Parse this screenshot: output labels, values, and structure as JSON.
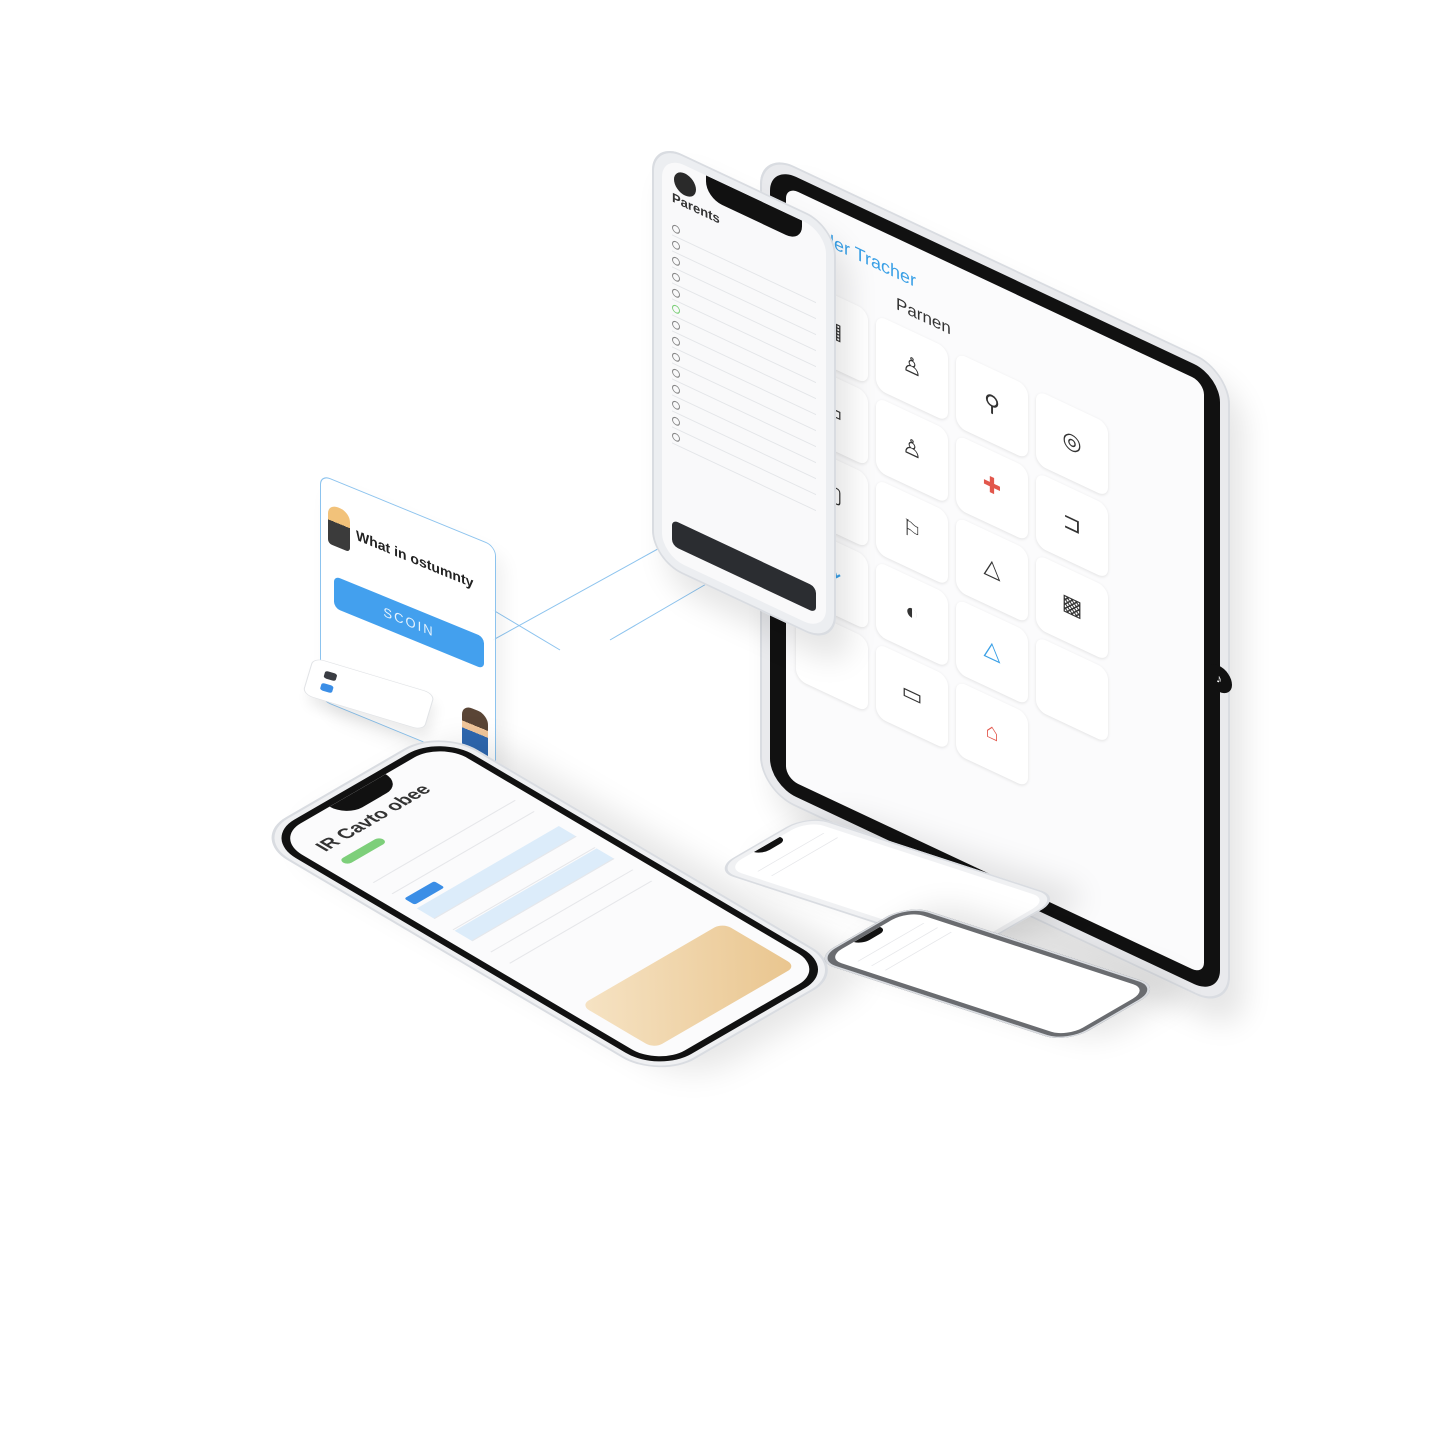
{
  "card": {
    "title": "What in ostumnty",
    "body": "",
    "button": "SCOIN"
  },
  "tag": {
    "line1": "",
    "line2": ""
  },
  "phoneA": {
    "title": "Parents",
    "rows": [
      "",
      "",
      "",
      "",
      "",
      "",
      "",
      "",
      "",
      "",
      "",
      "",
      "",
      ""
    ],
    "bottom_bar": ""
  },
  "tablet": {
    "title": "Order Tracher",
    "subtitle": "Parnen",
    "tiles": [
      {
        "icon": "▦",
        "label": ""
      },
      {
        "icon": "♙",
        "label": ""
      },
      {
        "icon": "⚲",
        "label": ""
      },
      {
        "icon": "◎",
        "label": ""
      },
      {
        "icon": "▭",
        "label": ""
      },
      {
        "icon": "♙",
        "label": ""
      },
      {
        "icon": "✚",
        "label": ""
      },
      {
        "icon": "⊐",
        "label": ""
      },
      {
        "icon": "▢",
        "label": ""
      },
      {
        "icon": "⚐",
        "label": ""
      },
      {
        "icon": "△",
        "label": ""
      },
      {
        "icon": "▩",
        "label": ""
      },
      {
        "icon": "⟳",
        "label": ""
      },
      {
        "icon": "◐",
        "label": ""
      },
      {
        "icon": "△",
        "label": ""
      },
      {
        "icon": "",
        "label": ""
      },
      {
        "icon": "",
        "label": ""
      },
      {
        "icon": "▭",
        "label": ""
      },
      {
        "icon": "⌂",
        "label": ""
      }
    ]
  },
  "phoneB": {
    "title": "IR Cavto obee",
    "rows": [
      "",
      "",
      "",
      "",
      "",
      "",
      ""
    ]
  },
  "phoneC": {
    "rows": [
      "",
      ""
    ]
  },
  "phoneD": {
    "rows": [
      "",
      "",
      ""
    ]
  },
  "colors": {
    "accent": "#3aa0e6",
    "alert": "#e2574c",
    "success": "#7dcf7a"
  }
}
